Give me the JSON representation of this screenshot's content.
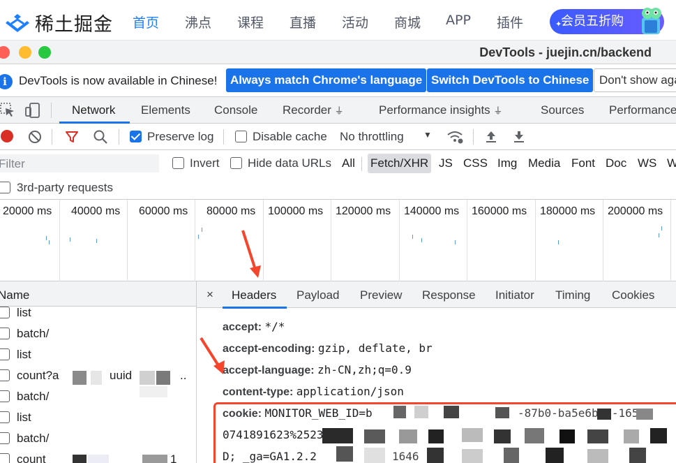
{
  "site": {
    "logo_text": "稀土掘金",
    "nav": [
      "首页",
      "沸点",
      "课程",
      "直播",
      "活动",
      "商城",
      "APP",
      "插件"
    ],
    "vip_label": "会员五折购"
  },
  "window": {
    "title": "DevTools - juejin.cn/backend"
  },
  "infobar": {
    "text": "DevTools is now available in Chinese!",
    "btn_match": "Always match Chrome's language",
    "btn_switch": "Switch DevTools to Chinese",
    "btn_dont": "Don't show again"
  },
  "panel_tabs": [
    "Network",
    "Elements",
    "Console",
    "Recorder",
    "Performance insights",
    "Sources",
    "Performance"
  ],
  "toolbar": {
    "preserve_log": "Preserve log",
    "disable_cache": "Disable cache",
    "throttling": "No throttling"
  },
  "filter": {
    "placeholder": "Filter",
    "invert": "Invert",
    "hide_data_urls": "Hide data URLs",
    "types": [
      "All",
      "Fetch/XHR",
      "JS",
      "CSS",
      "Img",
      "Media",
      "Font",
      "Doc",
      "WS",
      "W"
    ],
    "third_party": "3rd-party requests"
  },
  "overview": {
    "ticks": [
      "20000 ms",
      "40000 ms",
      "60000 ms",
      "80000 ms",
      "100000 ms",
      "120000 ms",
      "140000 ms",
      "160000 ms",
      "180000 ms",
      "200000 ms"
    ]
  },
  "requests": {
    "header": "Name",
    "rows": [
      "list",
      "batch/",
      "list",
      "count?a",
      "batch/",
      "list",
      "batch/",
      "count"
    ],
    "count_suffix_1": "uuid",
    "count_suffix_2": "..",
    "count_suffix_3": "1"
  },
  "detail": {
    "close": "×",
    "tabs": [
      "Headers",
      "Payload",
      "Preview",
      "Response",
      "Initiator",
      "Timing",
      "Cookies"
    ],
    "headers": [
      {
        "name": "accept:",
        "value": "*/*"
      },
      {
        "name": "accept-encoding:",
        "value": "gzip, deflate, br"
      },
      {
        "name": "accept-language:",
        "value": "zh-CN,zh;q=0.9"
      },
      {
        "name": "content-type:",
        "value": "application/json"
      }
    ],
    "cookie_name": "cookie:",
    "cookie_line1": "MONITOR_WEB_ID=b",
    "cookie_line1_tail": "-87b0-ba5e6bdf-165",
    "cookie_line2": "0741891623%2523",
    "cookie_line3": "D; _ga=GA1.2.2",
    "cookie_line3_tail": "1646"
  },
  "colors": {
    "accent": "#1a73e8",
    "brand": "#1e80ff",
    "annotation": "#f5462d"
  }
}
